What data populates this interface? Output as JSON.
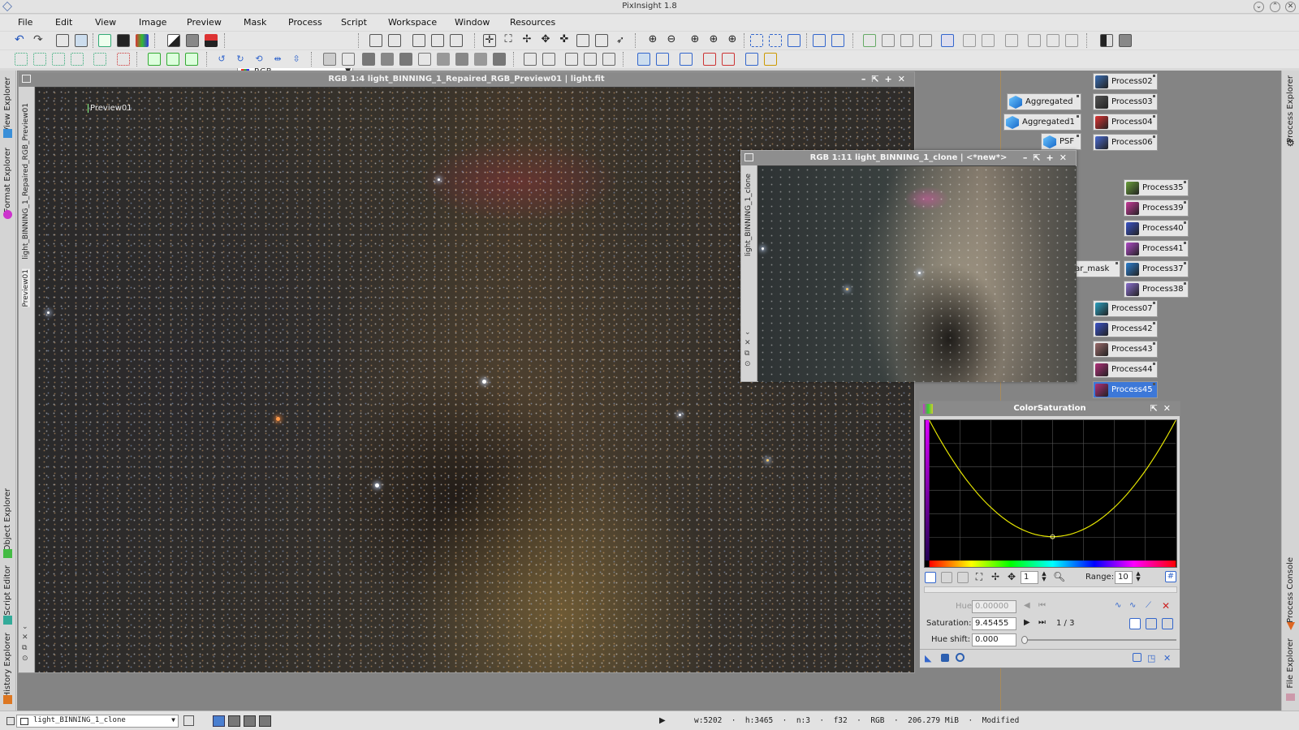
{
  "app": {
    "title": "PixInsight 1.8"
  },
  "menu": [
    "File",
    "Edit",
    "View",
    "Image",
    "Preview",
    "Mask",
    "Process",
    "Script",
    "Workspace",
    "Window",
    "Resources"
  ],
  "toolbar": {
    "color_space": "RGB"
  },
  "left_tabs": [
    "View Explorer",
    "Format Explorer",
    "Object Explorer",
    "Script Editor",
    "History Explorer"
  ],
  "right_tabs": [
    "Process Explorer",
    "Process Console",
    "File Explorer"
  ],
  "main_window": {
    "title": "RGB 1:4 light_BINNING_1_Repaired_RGB_Preview01 | light.fit",
    "side_tabs": [
      "light_BINNING_1_Repaired_RGB_Preview01",
      "Preview01"
    ],
    "preview_label": "Preview01"
  },
  "clone_window": {
    "title": "RGB 1:11 light_BINNING_1_clone | <*new*>",
    "side_tab": "light_BINNING_1_clone"
  },
  "process_icons": [
    {
      "label": "Process02",
      "color": "#3b6fb5"
    },
    {
      "label": "Process03",
      "color": "#555"
    },
    {
      "label": "Process04",
      "color": "#d33"
    },
    {
      "label": "Process06",
      "color": "#4a6bd1"
    },
    {
      "label": "Process35",
      "color": "#6a9f3a"
    },
    {
      "label": "Process39",
      "color": "#c83a9a"
    },
    {
      "label": "Process40",
      "color": "#3a52c8"
    },
    {
      "label": "Process41",
      "color": "#b04ac8"
    },
    {
      "label": "Process37",
      "color": "#2c7fd0"
    },
    {
      "label": "Process38",
      "color": "#8a6fd0"
    },
    {
      "label": "Process07",
      "color": "#2aa0c0"
    },
    {
      "label": "Process42",
      "color": "#3a52c8"
    },
    {
      "label": "Process43",
      "color": "#9a6a6a"
    },
    {
      "label": "Process44",
      "color": "#b0307a"
    },
    {
      "label": "Process45",
      "color": "#b0307a"
    }
  ],
  "aggregate_icons": [
    "Aggregated",
    "Aggregated1",
    "PSF",
    "star_mask"
  ],
  "color_saturation": {
    "title": "ColorSaturation",
    "zoom_value": "1",
    "range_label": "Range:",
    "range_value": "10",
    "hue_label": "Hue:",
    "hue_value": "0.00000",
    "saturation_label": "Saturation:",
    "saturation_value": "9.45455",
    "point_counter": "1 / 3",
    "hue_shift_label": "Hue shift:",
    "hue_shift_value": "0.000",
    "curve": {
      "points": [
        [
          0,
          1.0
        ],
        [
          0.5,
          0.17
        ],
        [
          1,
          1.0
        ]
      ]
    },
    "curve_color": "#e6e600"
  },
  "status": {
    "view_combo": "light_BINNING_1_clone",
    "info": "w:5202  ·  h:3465  ·  n:3  ·  f32  ·  RGB  ·  206.279 MiB  ·  Modified"
  }
}
